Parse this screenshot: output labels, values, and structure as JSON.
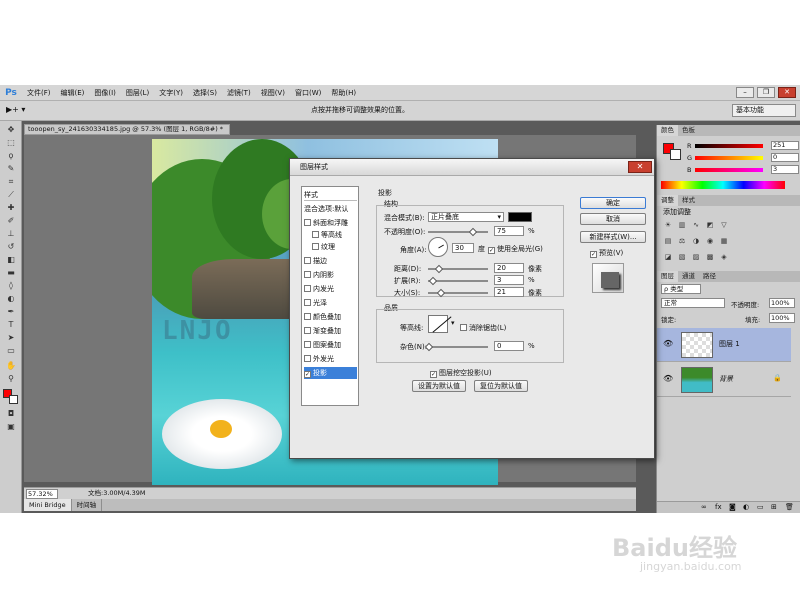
{
  "app": {
    "logo": "Ps"
  },
  "menu": [
    "文件(F)",
    "编辑(E)",
    "图像(I)",
    "图层(L)",
    "文字(Y)",
    "选择(S)",
    "滤镜(T)",
    "视图(V)",
    "窗口(W)",
    "帮助(H)"
  ],
  "options": {
    "tool_preset": "▶+ ▾",
    "hint": "点按并拖移可调整效果的位置。",
    "workspace": "基本功能"
  },
  "document": {
    "tab": "tooopen_sy_241630334185.jpg @ 57.3% (图层 1, RGB/8#) *",
    "zoom": "57.32%",
    "size": "文档:3.00M/4.39M",
    "bottom_tabs": [
      "Mini Bridge",
      "时间轴"
    ]
  },
  "dialog": {
    "title": "图层样式",
    "close": "✕",
    "list_header": "样式",
    "blend_default": "混合选项:默认",
    "styles": [
      {
        "label": "斜面和浮雕",
        "checked": false,
        "sub": false
      },
      {
        "label": "等高线",
        "checked": false,
        "sub": true
      },
      {
        "label": "纹理",
        "checked": false,
        "sub": true
      },
      {
        "label": "描边",
        "checked": false,
        "sub": false
      },
      {
        "label": "内阴影",
        "checked": false,
        "sub": false
      },
      {
        "label": "内发光",
        "checked": false,
        "sub": false
      },
      {
        "label": "光泽",
        "checked": false,
        "sub": false
      },
      {
        "label": "颜色叠加",
        "checked": false,
        "sub": false
      },
      {
        "label": "渐变叠加",
        "checked": false,
        "sub": false
      },
      {
        "label": "图案叠加",
        "checked": false,
        "sub": false
      },
      {
        "label": "外发光",
        "checked": false,
        "sub": false
      },
      {
        "label": "投影",
        "checked": true,
        "sub": false,
        "selected": true
      }
    ],
    "shadow": {
      "section": "投影",
      "struct": "结构",
      "blend_mode_label": "混合模式(B):",
      "blend_mode": "正片叠底",
      "shadow_color": "#000000",
      "opacity_label": "不透明度(O):",
      "opacity": "75",
      "opacity_unit": "%",
      "angle_label": "角度(A):",
      "angle": "30",
      "angle_unit": "度",
      "global_light": "使用全局光(G)",
      "distance_label": "距离(D):",
      "distance": "20",
      "spread_label": "扩展(R):",
      "spread": "3",
      "spread_unit": "%",
      "size_label": "大小(S):",
      "size": "21",
      "px_unit": "像素",
      "quality": "品质",
      "contour_label": "等高线:",
      "antialias": "消除锯齿(L)",
      "noise_label": "杂色(N):",
      "noise": "0",
      "noise_unit": "%",
      "knockout": "图层挖空投影(U)",
      "make_default": "设置为默认值",
      "reset_default": "复位为默认值"
    },
    "buttons": {
      "ok": "确定",
      "cancel": "取消",
      "new_style": "新建样式(W)...",
      "preview": "预览(V)"
    }
  },
  "panels": {
    "color_tabs": [
      "颜色",
      "色板"
    ],
    "color": {
      "r_label": "R",
      "g_label": "G",
      "b_label": "B",
      "r": "251",
      "g": "0",
      "b": "3",
      "foreground": "#fb0003"
    },
    "adjust_tabs": [
      "调整",
      "样式"
    ],
    "adjust_hint": "添加调整",
    "layers_tabs": [
      "图层",
      "通道",
      "路径"
    ],
    "kind": "ρ 类型",
    "blend": "正常",
    "opacity_label": "不透明度:",
    "opacity": "100%",
    "lock_label": "锁定:",
    "fill_label": "填充:",
    "fill": "100%",
    "layers": [
      {
        "name": "图层 1",
        "selected": true
      },
      {
        "name": "背景",
        "selected": false
      }
    ]
  },
  "watermark": {
    "brand": "Baidu经验",
    "url": "jingyan.baidu.com"
  }
}
